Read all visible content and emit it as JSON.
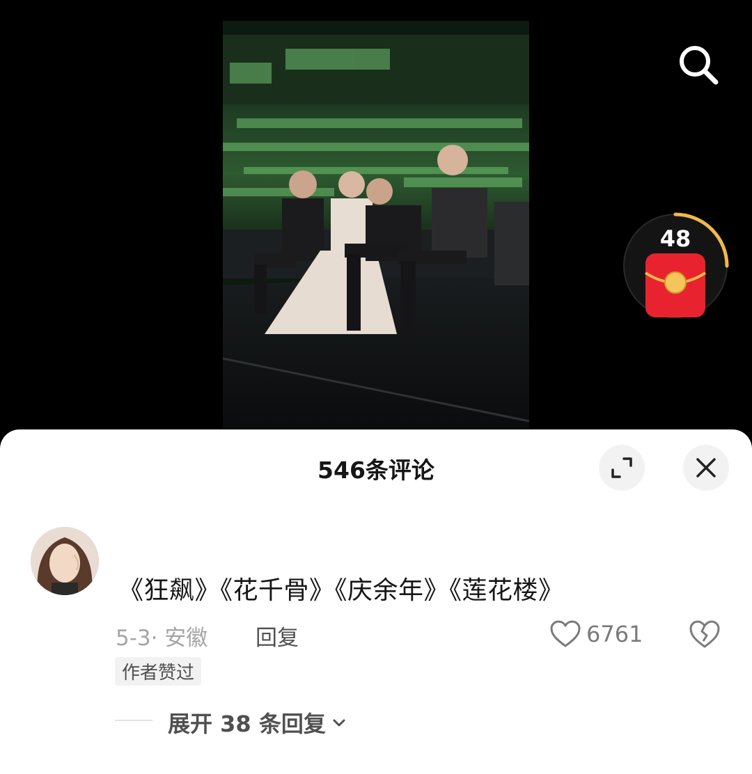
{
  "comments_panel": {
    "title": "546条评论"
  },
  "red_packet": {
    "count": "48",
    "ring_color": "#f0b94a",
    "packet_color": "#e8232f"
  },
  "comment": {
    "text": "《狂飙》《花千骨》《庆余年》《莲花楼》",
    "date_location": "5-3· 安徽",
    "reply_label": "回复",
    "like_count": "6761",
    "author_badge": "作者赞过",
    "expand_replies_label": "展开 38 条回复"
  },
  "icons": {
    "search": "search-icon",
    "expand": "expand-icon",
    "close": "close-icon",
    "like": "heart-icon",
    "dislike": "broken-heart-icon",
    "chevron": "chevron-down-icon"
  }
}
